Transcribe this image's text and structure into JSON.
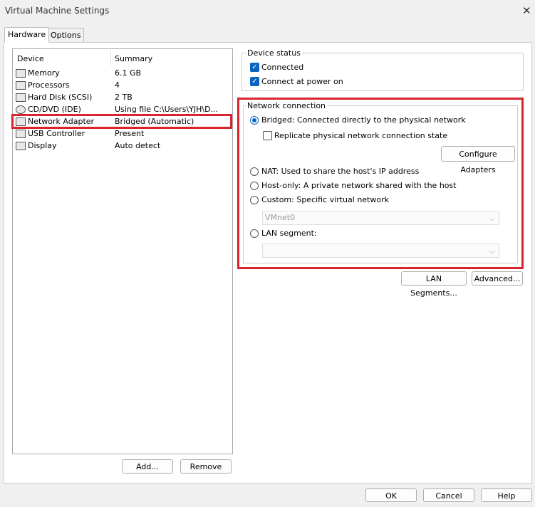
{
  "window": {
    "title": "Virtual Machine Settings",
    "close_glyph": "✕"
  },
  "tabs": [
    {
      "label": "Hardware",
      "active": true
    },
    {
      "label": "Options",
      "active": false
    }
  ],
  "device_list": {
    "headers": {
      "device": "Device",
      "summary": "Summary"
    },
    "rows": [
      {
        "icon": "memory-icon",
        "device": "Memory",
        "summary": "6.1 GB"
      },
      {
        "icon": "processor-icon",
        "device": "Processors",
        "summary": "4"
      },
      {
        "icon": "hard-disk-icon",
        "device": "Hard Disk (SCSI)",
        "summary": "2 TB"
      },
      {
        "icon": "cd-dvd-icon",
        "device": "CD/DVD (IDE)",
        "summary": "Using file C:\\Users\\YJH\\D..."
      },
      {
        "icon": "network-adapter-icon",
        "device": "Network Adapter",
        "summary": "Bridged (Automatic)",
        "selected": true
      },
      {
        "icon": "usb-icon",
        "device": "USB Controller",
        "summary": "Present"
      },
      {
        "icon": "display-icon",
        "device": "Display",
        "summary": "Auto detect"
      }
    ],
    "add_label": "Add...",
    "remove_label": "Remove"
  },
  "device_status": {
    "legend": "Device status",
    "connected": {
      "label": "Connected",
      "checked": true
    },
    "connect_at_power_on": {
      "label": "Connect at power on",
      "checked": true
    }
  },
  "network_connection": {
    "legend": "Network connection",
    "bridged": {
      "label": "Bridged: Connected directly to the physical network",
      "selected": true
    },
    "replicate": {
      "label": "Replicate physical network connection state",
      "checked": false
    },
    "configure_adapters_label": "Configure Adapters",
    "nat": {
      "label": "NAT: Used to share the host's IP address",
      "selected": false
    },
    "host_only": {
      "label": "Host-only: A private network shared with the host",
      "selected": false
    },
    "custom": {
      "label": "Custom: Specific virtual network",
      "selected": false
    },
    "custom_select_value": "VMnet0",
    "lan_segment": {
      "label": "LAN segment:",
      "selected": false
    },
    "lan_select_value": ""
  },
  "lan_segments_label": "LAN Segments...",
  "advanced_label": "Advanced...",
  "footer": {
    "ok": "OK",
    "cancel": "Cancel",
    "help": "Help"
  },
  "colors": {
    "accent": "#0a64c2",
    "highlight": "#d9232d"
  }
}
